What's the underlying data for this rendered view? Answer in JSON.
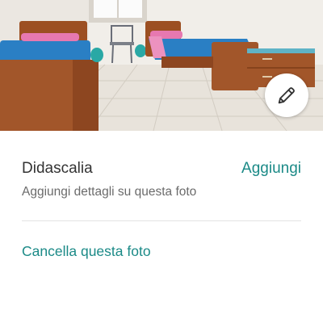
{
  "caption": {
    "title": "Didascalia",
    "add_label": "Aggiungi",
    "description": "Aggiungi dettagli su questa foto"
  },
  "actions": {
    "delete_label": "Cancella questa foto",
    "edit_icon": "pencil-icon"
  },
  "colors": {
    "accent": "#1b8a87",
    "title_text": "#333333",
    "secondary_text": "#6b6b6b",
    "divider": "#e3e3e3"
  }
}
